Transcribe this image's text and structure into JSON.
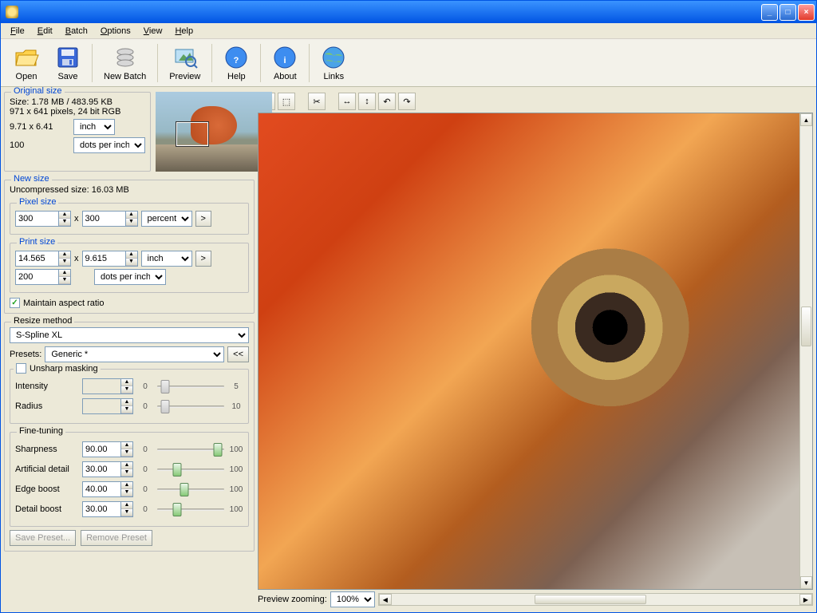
{
  "menu": {
    "file": "File",
    "edit": "Edit",
    "batch": "Batch",
    "options": "Options",
    "view": "View",
    "help": "Help"
  },
  "toolbar": {
    "open": "Open",
    "save": "Save",
    "newbatch": "New Batch",
    "preview": "Preview",
    "help": "Help",
    "about": "About",
    "links": "Links"
  },
  "original": {
    "legend": "Original size",
    "size_line": "Size: 1.78 MB / 483.95 KB",
    "px_line": "971 x 641 pixels, 24 bit RGB",
    "dim": "9.71 x 6.41",
    "dim_unit": "inch",
    "res": "100",
    "res_unit": "dots per inch"
  },
  "newsize": {
    "legend": "New size",
    "uncompressed": "Uncompressed size: 16.03 MB",
    "pixel_legend": "Pixel size",
    "pixel_w": "300",
    "pixel_h": "300",
    "pixel_unit": "percent",
    "print_legend": "Print size",
    "print_w": "14.565",
    "print_h": "9.615",
    "print_unit": "inch",
    "print_res": "200",
    "print_res_unit": "dots per inch",
    "aspect": "Maintain aspect ratio"
  },
  "resize": {
    "legend": "Resize method",
    "method": "S-Spline XL",
    "presets_lbl": "Presets:",
    "preset": "Generic *",
    "btn": "<<"
  },
  "unsharp": {
    "legend": "Unsharp masking",
    "intensity_lbl": "Intensity",
    "intensity_min": "0",
    "intensity_max": "5",
    "radius_lbl": "Radius",
    "radius_min": "0",
    "radius_max": "10"
  },
  "fine": {
    "legend": "Fine-tuning",
    "sharpness_lbl": "Sharpness",
    "sharpness": "90.00",
    "detail_lbl": "Artificial detail",
    "detail": "30.00",
    "edge_lbl": "Edge boost",
    "edge": "40.00",
    "detailb_lbl": "Detail boost",
    "detailb": "30.00",
    "min": "0",
    "max": "100"
  },
  "footer": {
    "save": "Save Preset...",
    "remove": "Remove Preset"
  },
  "bottom": {
    "zoomlbl": "Preview zooming:",
    "zoom": "100%"
  },
  "x": "x",
  "go": ">"
}
